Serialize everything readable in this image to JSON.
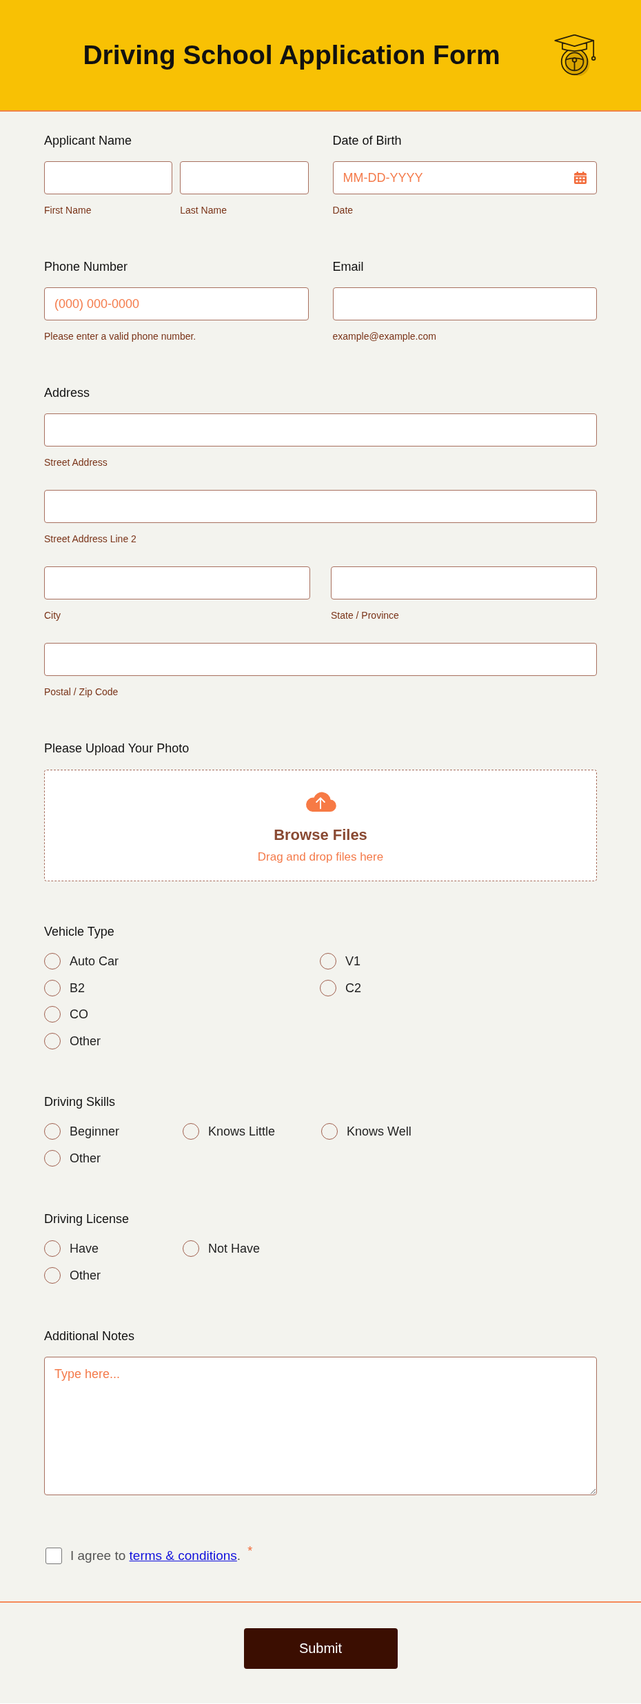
{
  "header": {
    "title": "Driving School Application Form"
  },
  "sections": [
    {
      "kind": "pair",
      "fields": [
        {
          "label": "Applicant Name",
          "rows": [
            [
              {
                "kind": "text",
                "sublabel": "First Name"
              },
              {
                "kind": "text",
                "sublabel": "Last Name"
              }
            ]
          ]
        },
        {
          "label": "Date of Birth",
          "rows": [
            [
              {
                "kind": "date",
                "placeholder": "MM-DD-YYYY",
                "sublabel": "Date"
              }
            ]
          ]
        }
      ]
    },
    {
      "kind": "pair",
      "fields": [
        {
          "label": "Phone Number",
          "rows": [
            [
              {
                "kind": "text",
                "placeholder": "(000) 000-0000",
                "sublabel": "Please enter a valid phone number."
              }
            ]
          ]
        },
        {
          "label": "Email",
          "rows": [
            [
              {
                "kind": "text",
                "sublabel": "example@example.com"
              }
            ]
          ]
        }
      ]
    },
    {
      "kind": "field",
      "label": "Address",
      "rows": [
        [
          {
            "kind": "text",
            "sublabel": "Street Address"
          }
        ],
        [
          {
            "kind": "text",
            "sublabel": "Street Address Line 2"
          }
        ],
        [
          {
            "kind": "text",
            "sublabel": "City"
          },
          {
            "kind": "text",
            "sublabel": "State / Province"
          }
        ],
        [
          {
            "kind": "text",
            "sublabel": "Postal / Zip Code"
          }
        ]
      ]
    },
    {
      "kind": "upload",
      "label": "Please Upload Your Photo",
      "button": "Browse Files",
      "hint": "Drag and drop files here"
    },
    {
      "kind": "radios",
      "label": "Vehicle Type",
      "columns": [
        [
          {
            "label": "Auto Car",
            "selected": false
          },
          {
            "label": "B2",
            "selected": false
          },
          {
            "label": "CO",
            "selected": false
          },
          {
            "label": "Other",
            "selected": false
          }
        ],
        [
          {
            "label": "V1",
            "selected": false
          },
          {
            "label": "C2",
            "selected": false
          }
        ]
      ]
    },
    {
      "kind": "radios",
      "label": "Driving Skills",
      "columns": [
        [
          {
            "label": "Beginner",
            "selected": false
          },
          {
            "label": "Other",
            "selected": false
          }
        ],
        [
          {
            "label": "Knows Little",
            "selected": false
          }
        ],
        [
          {
            "label": "Knows Well",
            "selected": false
          }
        ]
      ]
    },
    {
      "kind": "radios",
      "label": "Driving License",
      "columns": [
        [
          {
            "label": "Have",
            "selected": false
          },
          {
            "label": "Other",
            "selected": false
          }
        ],
        [
          {
            "label": "Not Have",
            "selected": false
          }
        ]
      ]
    },
    {
      "kind": "textarea",
      "label": "Additional Notes",
      "placeholder": "Type here..."
    },
    {
      "kind": "agree",
      "text": "I agree to",
      "link": "terms & conditions",
      "after": ".",
      "mark": "*",
      "checked": false
    }
  ],
  "submit": {
    "label": "Submit"
  }
}
